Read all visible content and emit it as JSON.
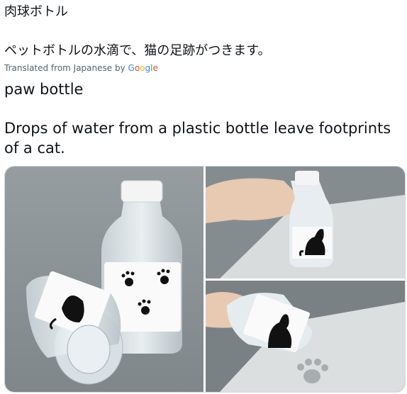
{
  "tweet": {
    "original_title": "肉球ボトル",
    "original_body": "ペットボトルの水滴で、猫の足跡がつきます。",
    "translated_label": "Translated from Japanese by",
    "google_logo": [
      "G",
      "o",
      "o",
      "g",
      "l",
      "e"
    ],
    "translated_title": "paw bottle",
    "translated_body": "Drops of water from a plastic bottle leave footprints of a cat."
  },
  "media": {
    "count": 3,
    "background_color": "#8a9195",
    "photos": [
      {
        "name": "two-bottles-photo"
      },
      {
        "name": "hand-holding-bottle-photo"
      },
      {
        "name": "paw-print-on-paper-photo"
      }
    ]
  },
  "colors": {
    "text": "#0f1419",
    "secondary_text": "#536471",
    "border": "#cfd9de"
  }
}
